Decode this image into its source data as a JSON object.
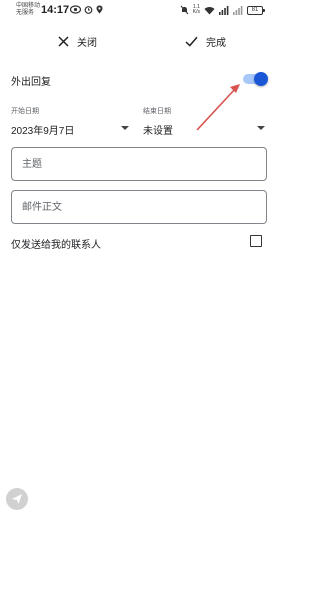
{
  "status_bar": {
    "carrier_line1": "中国移动",
    "carrier_line2": "无服务",
    "time": "14:17",
    "network_speed_value": "1.1",
    "network_speed_unit": "K/s",
    "battery": "81"
  },
  "action_bar": {
    "close_label": "关闭",
    "done_label": "完成"
  },
  "auto_reply": {
    "label": "外出回复",
    "enabled": true,
    "accent_color": "#1a57d6"
  },
  "dates": {
    "start_caption": "开始日期",
    "start_value": "2023年9月7日",
    "end_caption": "结束日期",
    "end_value": "未设置"
  },
  "fields": {
    "subject_placeholder": "主题",
    "body_placeholder": "邮件正文"
  },
  "contacts_only": {
    "label": "仅发送给我的联系人",
    "checked": false
  },
  "annotation": {
    "arrow_color": "#d9534f"
  }
}
